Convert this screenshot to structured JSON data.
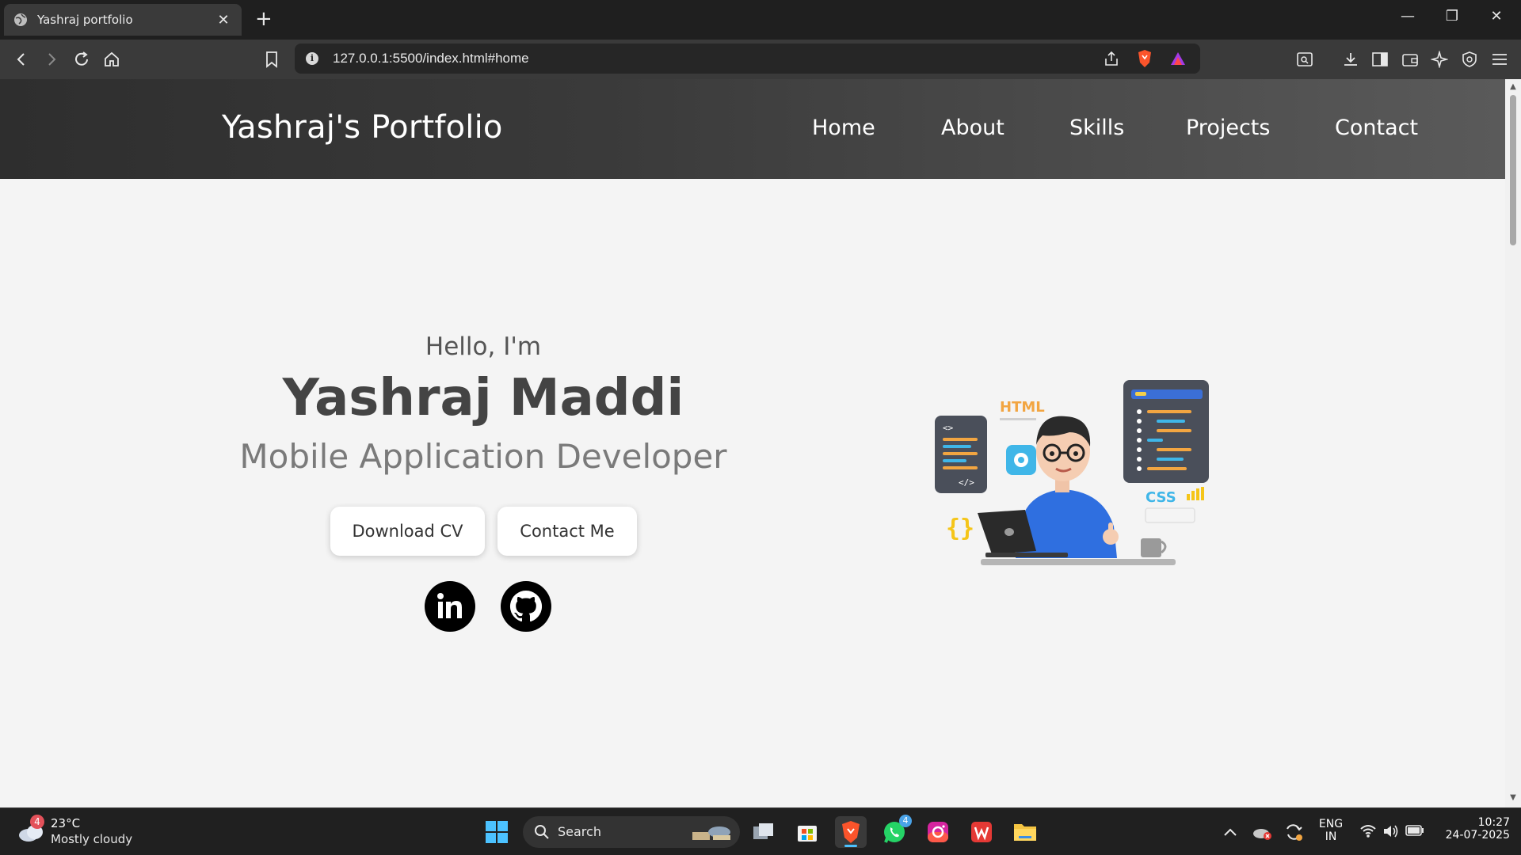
{
  "browser": {
    "tab_title": "Yashraj portfolio",
    "url": "127.0.0.1:5500/index.html#home"
  },
  "navbar": {
    "brand": "Yashraj's Portfolio",
    "links": [
      "Home",
      "About",
      "Skills",
      "Projects",
      "Contact"
    ]
  },
  "hero": {
    "greeting": "Hello, I'm",
    "name": "Yashraj Maddi",
    "role": "Mobile Application Developer",
    "buttons": {
      "download": "Download CV",
      "contact": "Contact Me"
    },
    "illustration": {
      "html_label": "HTML",
      "css_label": "CSS"
    }
  },
  "taskbar": {
    "weather_badge": "4",
    "temperature": "23°C",
    "weather": "Mostly cloudy",
    "search_label": "Search",
    "whatsapp_badge": "4",
    "language_line1": "ENG",
    "language_line2": "IN",
    "time": "10:27",
    "date": "24-07-2025"
  },
  "colors": {
    "page_bg": "#f4f4f4",
    "navbar_dark": "#2e2e2e",
    "navbar_light": "#5a5a5a",
    "text_dark": "#444444",
    "text_muted": "#7a7a7a"
  }
}
